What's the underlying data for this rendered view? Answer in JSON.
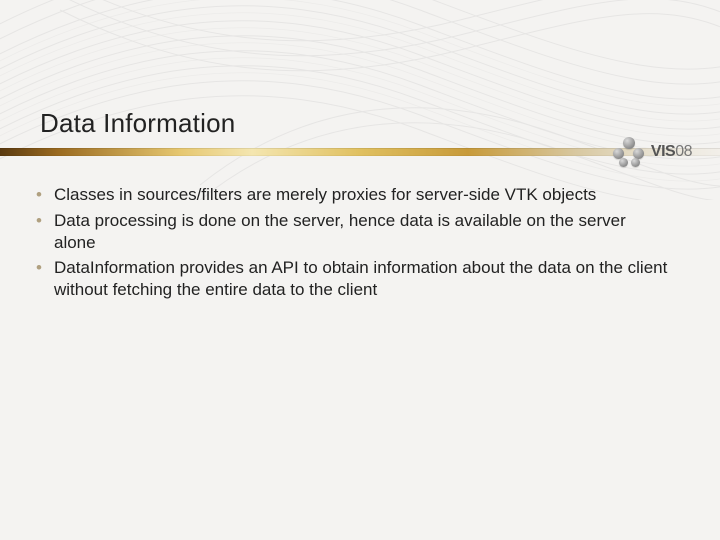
{
  "title": "Data Information",
  "logo": {
    "text_main": "VIS",
    "text_sub": "08"
  },
  "bullets": [
    "Classes in sources/filters are merely proxies for server-side VTK objects",
    "Data processing is done on the server, hence data is available on the server alone",
    "DataInformation provides an API to obtain information about the data on the client without fetching the entire data to the client"
  ]
}
